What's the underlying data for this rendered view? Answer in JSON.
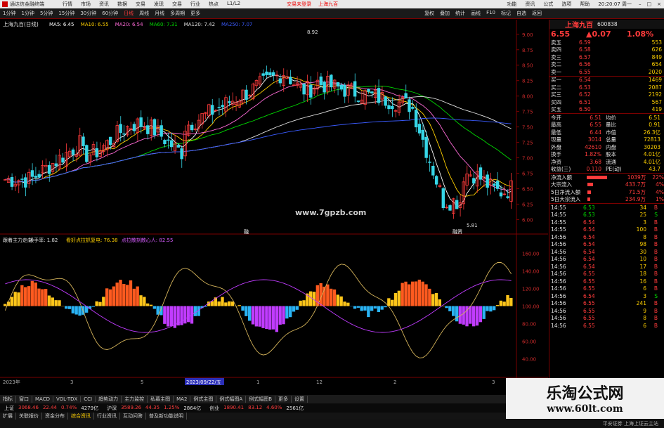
{
  "window": {
    "app_title": "通达信金融终端",
    "menus": [
      "行情",
      "市场",
      "资讯",
      "数据",
      "交易",
      "发现",
      "交易",
      "行业",
      "热点",
      "L1/L2"
    ],
    "notice": "交易未登录",
    "stock_tag": "上海九百",
    "right_menus": [
      "功能",
      "资讯",
      "公式",
      "选项",
      "帮助"
    ],
    "time": "20:20:07 周一"
  },
  "toolbar": {
    "periods": [
      "1分钟",
      "1分钟",
      "5分钟",
      "15分钟",
      "30分钟",
      "60分钟",
      "日线",
      "周线",
      "月线",
      "多周期",
      "更多"
    ],
    "active_period": "日线",
    "right_tools": [
      "复权",
      "叠加",
      "统计",
      "画线",
      "F10",
      "标记",
      "自选",
      "返回"
    ]
  },
  "main_chart": {
    "title": "上海九百(日线)",
    "ma_legend": [
      {
        "label": "MA5: 6.45",
        "color": "#ffffff"
      },
      {
        "label": "MA10: 6.55",
        "color": "#ffd000"
      },
      {
        "label": "MA20: 6.54",
        "color": "#ff6bd8"
      },
      {
        "label": "MA60: 7.31",
        "color": "#00d900"
      },
      {
        "label": "MA120: 7.42",
        "color": "#e0e0e0"
      },
      {
        "label": "MA250: 7.07",
        "color": "#3a5bff"
      }
    ],
    "high_label": "8.92",
    "low_label": "5.81",
    "price_ticks": [
      "9.00",
      "8.75",
      "8.50",
      "8.25",
      "8.00",
      "7.75",
      "7.50",
      "7.25",
      "7.00",
      "6.75",
      "6.50",
      "6.25",
      "6.00"
    ],
    "watermark_url": "www.7gpzb.com",
    "marker_1": "融",
    "marker_2": "融资"
  },
  "indicator": {
    "legend": [
      {
        "label": "跟着主力走向",
        "color": "#e0e0e0"
      },
      {
        "label": "换手率: 1.82",
        "color": "#e0e0e0"
      },
      {
        "label": "看好点拉抓复电: 76.38",
        "color": "#ffd000"
      },
      {
        "label": "点拉散刻散心人: 82.55",
        "color": "#d65cff"
      }
    ],
    "ticks": [
      "160.00",
      "140.00",
      "120.00",
      "100.00",
      "80.00",
      "60.00",
      "40.00"
    ]
  },
  "date_axis": {
    "labels": [
      "2023年",
      "3",
      "5",
      "2023/09/22/五",
      "1",
      "12",
      "2",
      "3"
    ]
  },
  "quote": {
    "name": "上海九百",
    "code": "600838",
    "price": "6.55",
    "change": "▲0.07",
    "pct": "1.08%",
    "asks": [
      {
        "label": "卖五",
        "price": "6.59",
        "vol": "553"
      },
      {
        "label": "卖四",
        "price": "6.58",
        "vol": "626"
      },
      {
        "label": "卖三",
        "price": "6.57",
        "vol": "849"
      },
      {
        "label": "卖二",
        "price": "6.56",
        "vol": "654"
      },
      {
        "label": "卖一",
        "price": "6.55",
        "vol": "2020"
      }
    ],
    "bids": [
      {
        "label": "买一",
        "price": "6.54",
        "vol": "1469"
      },
      {
        "label": "买二",
        "price": "6.53",
        "vol": "2087"
      },
      {
        "label": "买三",
        "price": "6.52",
        "vol": "2192"
      },
      {
        "label": "买四",
        "price": "6.51",
        "vol": "567"
      },
      {
        "label": "买五",
        "price": "6.50",
        "vol": "419"
      }
    ],
    "stats": [
      {
        "k1": "今开",
        "v1": "6.51",
        "k2": "均价",
        "v2": "6.51"
      },
      {
        "k1": "最高",
        "v1": "6.55",
        "k2": "量比",
        "v2": "0.91"
      },
      {
        "k1": "最低",
        "v1": "6.44",
        "k2": "市值",
        "v2": "26.3亿"
      },
      {
        "k1": "现量",
        "v1": "3014",
        "k2": "总量",
        "v2": "72813"
      },
      {
        "k1": "外盘",
        "v1": "42610",
        "k2": "内盘",
        "v2": "30203"
      },
      {
        "k1": "换手",
        "v1": "1.82%",
        "k2": "股本",
        "v2": "4.01亿"
      },
      {
        "k1": "净资",
        "v1": "3.68",
        "k2": "流通",
        "v2": "4.01亿"
      },
      {
        "k1": "收益(三)",
        "v1": "0.110",
        "k2": "PE(动)",
        "v2": "43.7"
      }
    ],
    "flows": [
      {
        "label": "净流入额",
        "value": "1039万",
        "pct": "22%",
        "bar": 0.22
      },
      {
        "label": "大宗流入",
        "value": "433.7万",
        "pct": "4%",
        "bar": 0.06
      },
      {
        "label": "5日净流入额",
        "value": "71.5万",
        "pct": "4%",
        "bar": 0.04
      },
      {
        "label": "5日大宗流入",
        "value": "234.9万",
        "pct": "1%",
        "bar": 0.03
      }
    ],
    "ticks": [
      {
        "t": "14:55",
        "p": "6.53",
        "v": "34",
        "d": "B"
      },
      {
        "t": "14:55",
        "p": "6.53",
        "v": "25",
        "d": "S"
      },
      {
        "t": "14:55",
        "p": "6.54",
        "v": "3",
        "d": "B"
      },
      {
        "t": "14:55",
        "p": "6.54",
        "v": "100",
        "d": "B"
      },
      {
        "t": "14:56",
        "p": "6.54",
        "v": "8",
        "d": "B"
      },
      {
        "t": "14:56",
        "p": "6.54",
        "v": "98",
        "d": "B"
      },
      {
        "t": "14:56",
        "p": "6.54",
        "v": "30",
        "d": "B"
      },
      {
        "t": "14:56",
        "p": "6.54",
        "v": "10",
        "d": "B"
      },
      {
        "t": "14:56",
        "p": "6.54",
        "v": "17",
        "d": "B"
      },
      {
        "t": "14:56",
        "p": "6.55",
        "v": "18",
        "d": "B"
      },
      {
        "t": "14:56",
        "p": "6.55",
        "v": "16",
        "d": "B"
      },
      {
        "t": "14:56",
        "p": "6.55",
        "v": "6",
        "d": "B"
      },
      {
        "t": "14:56",
        "p": "6.54",
        "v": "3",
        "d": "S"
      },
      {
        "t": "14:56",
        "p": "6.55",
        "v": "241",
        "d": "B"
      },
      {
        "t": "14:56",
        "p": "6.55",
        "v": "9",
        "d": "B"
      },
      {
        "t": "14:56",
        "p": "6.55",
        "v": "8",
        "d": "B"
      },
      {
        "t": "14:56",
        "p": "6.55",
        "v": "6",
        "d": "B"
      }
    ]
  },
  "bottom_tabs": [
    "指标",
    "窗口",
    "MACD",
    "VOL-TDX",
    "CCI",
    "趋势动力",
    "主力监控",
    "私募主图",
    "MA2",
    "例式主图",
    "例式幅图A",
    "例式幅图B",
    "更多",
    "设置"
  ],
  "bottom_tabs_sub": [
    "扩展",
    "关联报价",
    "资金分布",
    "综合资讯",
    "行业资讯",
    "互动问答",
    "普及新功能说明"
  ],
  "active_sub_tab": "综合资讯",
  "index_bar": [
    {
      "name": "上证",
      "v": "3068.46",
      "c": "22.44",
      "p": "0.74%",
      "amt": "4279亿"
    },
    {
      "name": "沪深",
      "v": "3589.26",
      "c": "44.35",
      "p": "1.25%",
      "amt": "2864亿"
    },
    {
      "name": "创业",
      "v": "1890.41",
      "c": "83.12",
      "p": "4.60%",
      "amt": "2561亿"
    }
  ],
  "status_right": "平安证券 上海上证云主站",
  "site_banner": {
    "title": "乐淘公式网",
    "url": "www.60lt.com"
  },
  "colors": {
    "up": "#ff3b3b",
    "down": "#00d900",
    "grid": "#7a0000",
    "bg": "#000000"
  }
}
